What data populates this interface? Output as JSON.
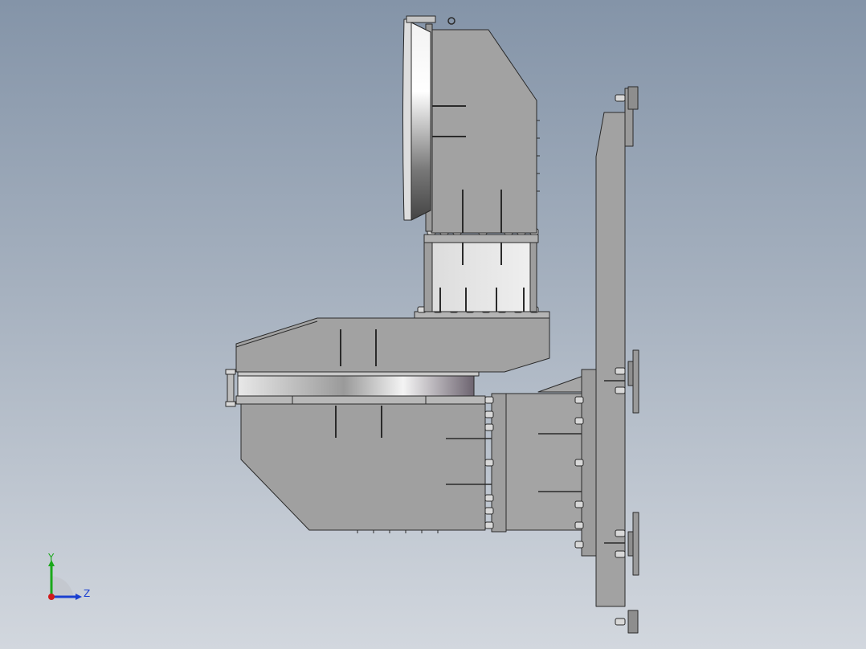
{
  "viewport": {
    "background_top": "#8494a8",
    "background_bottom": "#d2d7de"
  },
  "model": {
    "part_fill": "#a0a0a0",
    "part_dark": "#8a8a8a",
    "edge_color": "#2a2a2a",
    "bolt_fill": "#d8d8d8"
  },
  "triad": {
    "y_label": "Y",
    "z_label": "Z",
    "y_color": "#1aa81a",
    "z_color": "#1a3fd0",
    "x_color": "#d01a1a"
  }
}
